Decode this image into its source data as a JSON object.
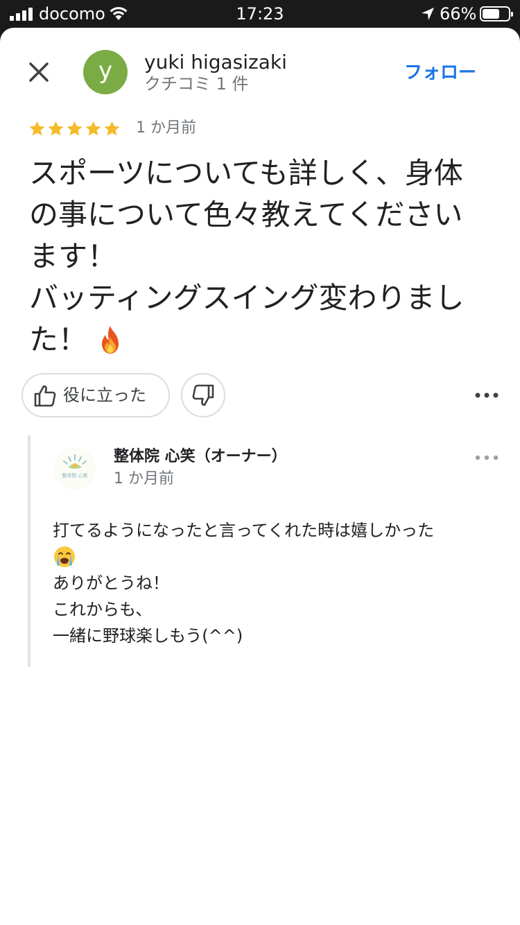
{
  "status_bar": {
    "carrier": "docomo",
    "time": "17:23",
    "battery_percent_label": "66%",
    "battery_level": 0.66
  },
  "reviewer": {
    "avatar_letter": "y",
    "avatar_color": "#7aab45",
    "name": "yuki higasizaki",
    "review_count": "クチコミ 1 件",
    "follow_label": "フォロー"
  },
  "review": {
    "rating": 5,
    "date": "1 か月前",
    "text": "スポーツについても詳しく、身体の事について色々教えてくださいます！\nバッティングスイング変わりました！",
    "trailing_emoji": "fire-icon"
  },
  "actions": {
    "helpful_label": "役に立った"
  },
  "owner_reply": {
    "owner_name": "整体院 心笑（オーナー）",
    "date": "1 か月前",
    "logo_text": "整体院 心笑",
    "line1": "打てるようになったと言ってくれた時は嬉しかった",
    "emoji": "crying-face-icon",
    "rest": "ありがとうね！\nこれからも、\n一緒に野球楽しもう(^^)"
  },
  "colors": {
    "accent": "#1a73e8",
    "star": "#f6bb2b",
    "secondary_text": "#70757a"
  }
}
